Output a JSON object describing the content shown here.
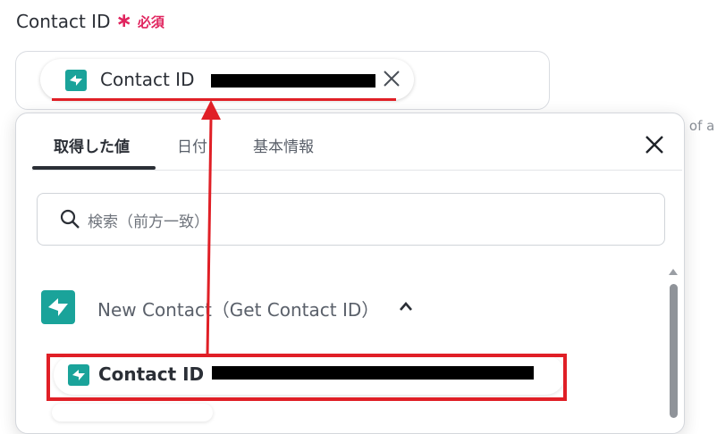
{
  "field": {
    "label": "Contact ID",
    "required_mark": "∗",
    "required_text": "必須"
  },
  "chip": {
    "label": "Contact ID"
  },
  "background_text": "l of a",
  "dropdown": {
    "tabs": [
      {
        "label": "取得した値",
        "active": true
      },
      {
        "label": "日付",
        "active": false
      },
      {
        "label": "基本情報",
        "active": false
      }
    ],
    "search": {
      "placeholder": "検索（前方一致）"
    },
    "group": {
      "label": "New Contact（Get Contact ID）",
      "expanded": true
    },
    "items": [
      {
        "label": "Contact ID"
      }
    ]
  },
  "colors": {
    "brand_teal": "#1aa39a",
    "required": "#e0245e",
    "annotation_red": "#e01f26"
  },
  "icons": {
    "app_icon": "hubspot-style-teal-icon",
    "close": "close-icon",
    "search": "search-icon",
    "chevron": "chevron-up-icon"
  }
}
